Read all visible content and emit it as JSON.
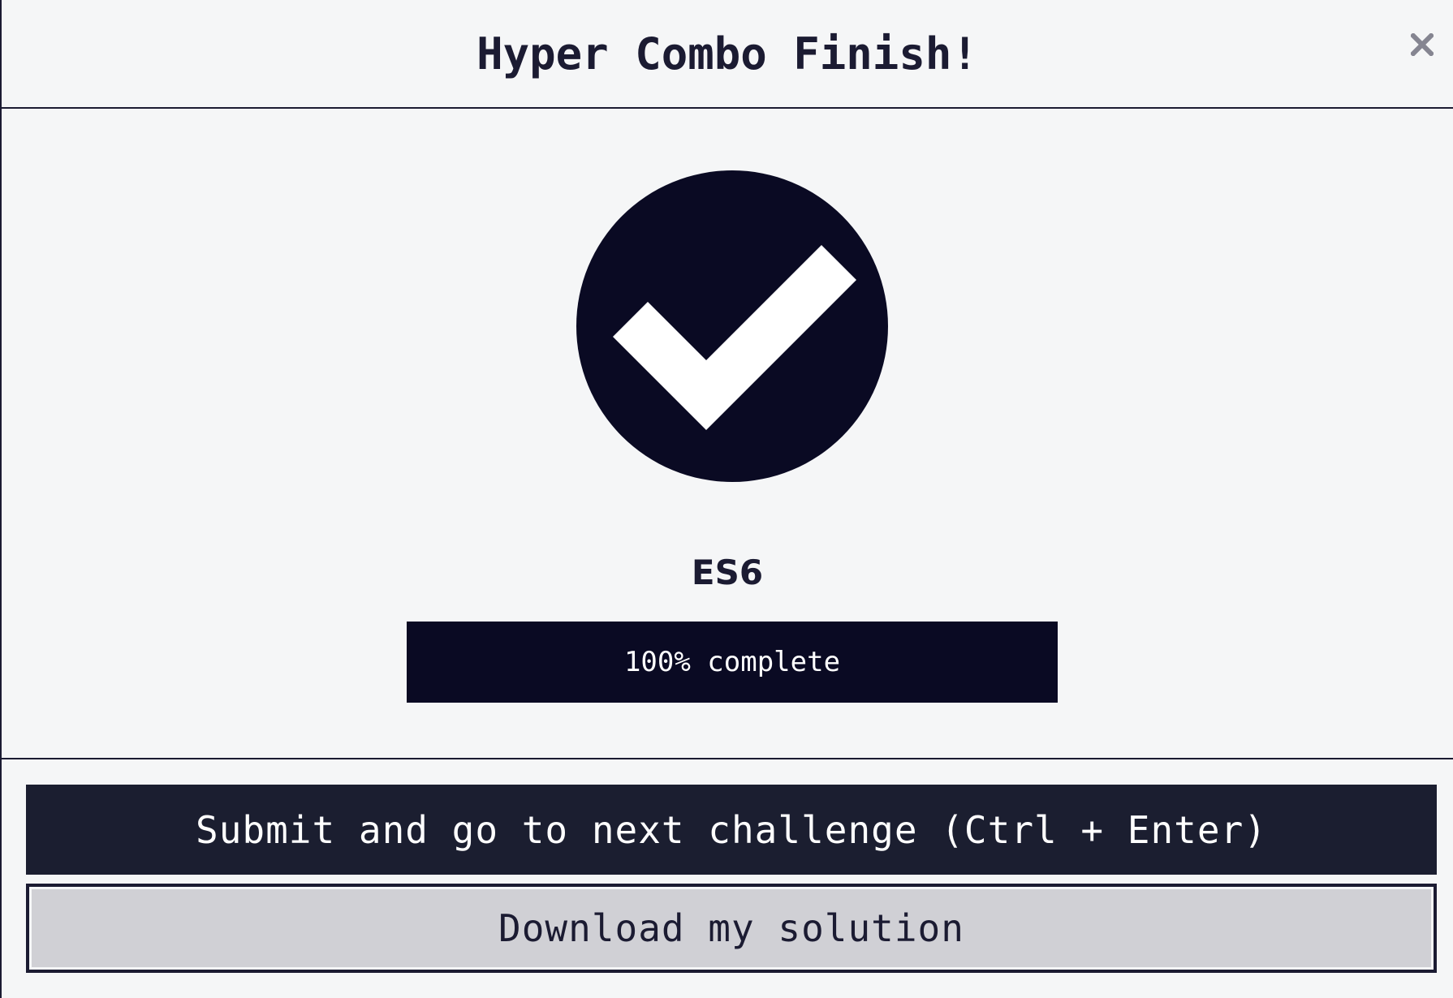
{
  "modal": {
    "title": "Hyper Combo Finish!",
    "close_label": "×"
  },
  "completion": {
    "icon": "check-circle-icon",
    "certification_title": "ES6",
    "progress_percent": 100,
    "progress_text": "100% complete"
  },
  "actions": {
    "submit_label": "Submit and go to next challenge (Ctrl + Enter)",
    "download_label": "Download my solution"
  },
  "colors": {
    "background": "#f5f6f7",
    "dark": "#0a0a23",
    "primary_button": "#1b1e30",
    "secondary_button": "#d0d0d5",
    "close_icon": "#858591"
  }
}
